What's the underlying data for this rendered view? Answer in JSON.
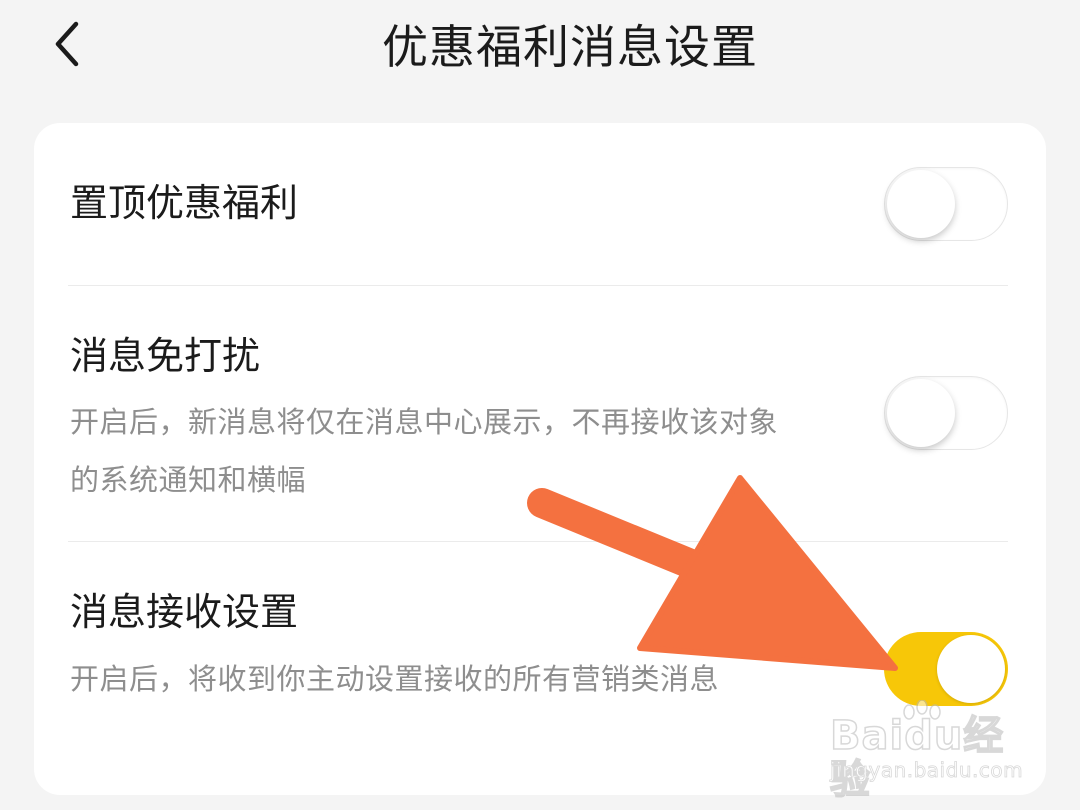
{
  "header": {
    "title": "优惠福利消息设置",
    "back_icon": "chevron-left-icon"
  },
  "settings": [
    {
      "title": "置顶优惠福利",
      "description": "",
      "enabled": false
    },
    {
      "title": "消息免打扰",
      "description": "开启后，新消息将仅在消息中心展示，不再接收该对象的系统通知和横幅",
      "enabled": false
    },
    {
      "title": "消息接收设置",
      "description": "开启后，将收到你主动设置接收的所有营销类消息",
      "enabled": true
    }
  ],
  "colors": {
    "toggle_on": "#f7c708",
    "arrow": "#f47140",
    "background": "#f4f4f4"
  },
  "watermark": {
    "brand": "Baidu经验",
    "url": "jingyan.baidu.com"
  }
}
